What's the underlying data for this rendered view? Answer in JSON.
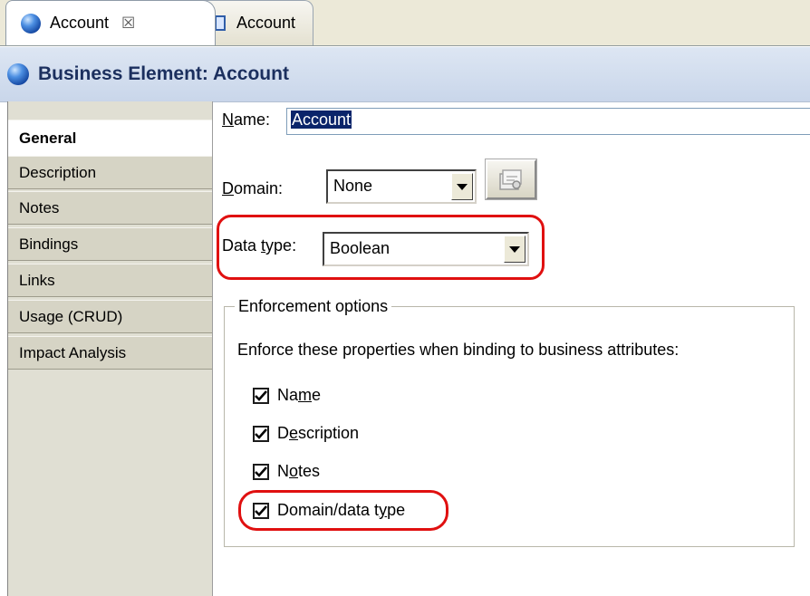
{
  "tabs": [
    {
      "label": "Account",
      "active": true,
      "close_symbol": "☒"
    },
    {
      "label": "Account",
      "active": false
    }
  ],
  "header": {
    "title": "Business Element: Account"
  },
  "nav": {
    "items": [
      {
        "label": "General",
        "selected": true
      },
      {
        "label": "Description"
      },
      {
        "label": "Notes"
      },
      {
        "label": "Bindings"
      },
      {
        "label": "Links"
      },
      {
        "label": "Usage (CRUD)"
      },
      {
        "label": "Impact Analysis"
      }
    ]
  },
  "form": {
    "name_label_prefix": "N",
    "name_label_rest": "ame:",
    "name_value": "Account",
    "domain_label_prefix": "D",
    "domain_label_rest": "omain:",
    "domain_value": "None",
    "datatype_label_pre": "Data ",
    "datatype_label_u": "t",
    "datatype_label_post": "ype:",
    "datatype_value": "Boolean"
  },
  "enforcement": {
    "title": "Enforcement options",
    "instructions": "Enforce these properties when binding to business attributes:",
    "options": [
      {
        "pre": "Na",
        "u": "m",
        "post": "e",
        "checked": true
      },
      {
        "pre": "D",
        "u": "e",
        "post": "scription",
        "checked": true
      },
      {
        "pre": "N",
        "u": "o",
        "post": "tes",
        "checked": true
      },
      {
        "pre": "Domain/data t",
        "u": "y",
        "post": "pe",
        "checked": true
      }
    ]
  },
  "colors": {
    "highlight": "#e01010",
    "selection": "#0a246a",
    "header_text": "#1b2f5e"
  }
}
